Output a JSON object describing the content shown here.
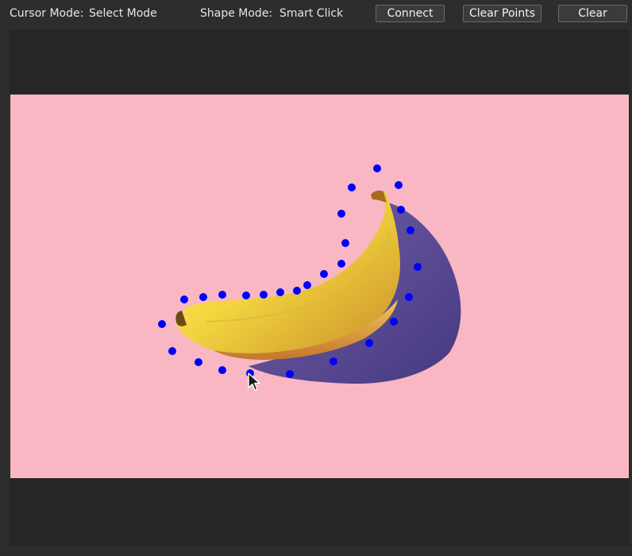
{
  "toolbar": {
    "cursor_mode_label": "Cursor Mode:",
    "cursor_mode_value": "Select Mode",
    "shape_mode_label": "Shape Mode:",
    "shape_mode_value": "Smart Click",
    "connect_label": "Connect",
    "clear_points_label": "Clear Points",
    "clear_label": "Clear"
  },
  "canvas": {
    "image_subject": "banana on pink background",
    "background_color": "#f8b7c3",
    "point_color": "#0000ff",
    "point_count": 31
  },
  "cursor": {
    "icon": "mouse-pointer-icon"
  }
}
